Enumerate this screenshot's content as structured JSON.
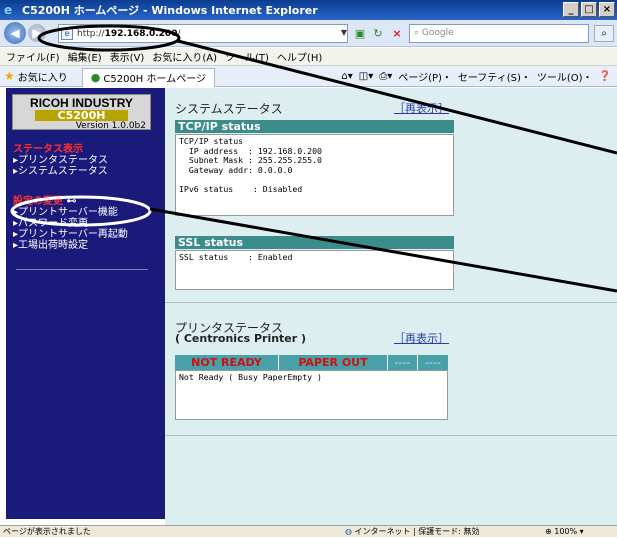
{
  "window": {
    "title": "C5200H ホームページ - Windows Internet Explorer",
    "min": "_",
    "max": "□",
    "close": "×"
  },
  "nav": {
    "url_prefix": "http://",
    "url_host": "192.168.0.200",
    "url_suffix": "/",
    "search_placeholder": "Google"
  },
  "menu": [
    "ファイル(F)",
    "編集(E)",
    "表示(V)",
    "お気に入り(A)",
    "ツール(T)",
    "ヘルプ(H)"
  ],
  "favorites_label": "お気に入り",
  "tab_label": "C5200H ホームページ",
  "command_bar": [
    "ページ(P)・",
    "セーフティ(S)・",
    "ツール(O)・"
  ],
  "sidebar": {
    "brand": "RICOH INDUSTRY",
    "model": "C5200H",
    "version": "Version 1.0.0b2",
    "status_heading": "ステータス表示",
    "status_links": [
      "▸プリンタステータス",
      "▸システムステータス"
    ],
    "settings_heading": "設定の変更",
    "settings_links": [
      "▸プリントサーバー機能",
      "▸パスワード変更",
      "▸プリントサーバー再起動",
      "▸工場出荷時設定"
    ]
  },
  "system_status": {
    "title": "システムステータス",
    "refresh": "［再表示］",
    "tcpip_header": "TCP/IP status",
    "tcpip_body": "TCP/IP status\n  IP address  : 192.168.0.200\n  Subnet Mask : 255.255.255.0\n  Gateway addr: 0.0.0.0\n\nIPv6 status    : Disabled",
    "ssl_header": "SSL status",
    "ssl_body": "SSL status    : Enabled"
  },
  "printer_status": {
    "title": "プリンタステータス",
    "subtitle": "( Centronics Printer )",
    "refresh": "［再表示］",
    "cells": [
      "NOT READY",
      "PAPER OUT",
      "----",
      "----"
    ],
    "body": "Not Ready ( Busy PaperEmpty )"
  },
  "statusbar": {
    "left": "ページが表示されました",
    "middle": "インターネット | 保護モード: 無効",
    "zoom": "100%"
  }
}
